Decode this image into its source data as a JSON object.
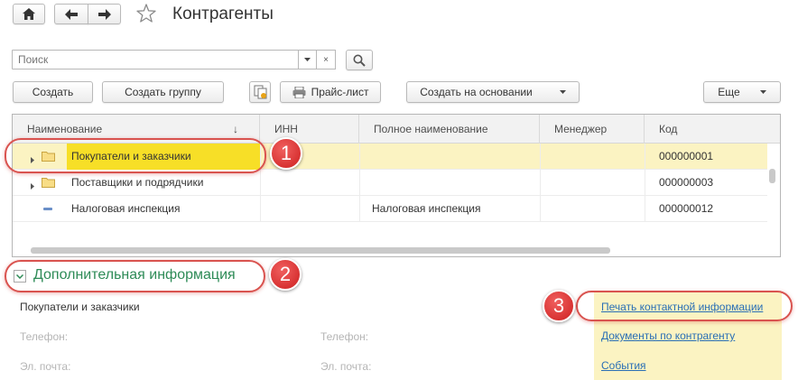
{
  "header": {
    "title": "Контрагенты"
  },
  "search": {
    "placeholder": "Поиск",
    "clear_label": "×"
  },
  "toolbar": {
    "create_label": "Создать",
    "create_group_label": "Создать группу",
    "price_list_label": "Прайс-лист",
    "create_based_label": "Создать на основании",
    "more_label": "Еще"
  },
  "table": {
    "columns": [
      "Наименование",
      "ИНН",
      "Полное наименование",
      "Менеджер",
      "Код"
    ],
    "sort_indicator": "↓",
    "rows": [
      {
        "name": "Покупатели и заказчики",
        "inn": "",
        "full_name": "",
        "manager": "",
        "code": "000000001",
        "type": "group",
        "selected": true
      },
      {
        "name": "Поставщики и подрядчики",
        "inn": "",
        "full_name": "",
        "manager": "",
        "code": "000000003",
        "type": "group",
        "selected": false
      },
      {
        "name": "Налоговая инспекция",
        "inn": "",
        "full_name": "Налоговая инспекция",
        "manager": "",
        "code": "000000012",
        "type": "item",
        "selected": false
      }
    ]
  },
  "additional_info": {
    "title": "Дополнительная информация",
    "group_name": "Покупатели и заказчики",
    "phone_label_left": "Телефон:",
    "email_label_left": "Эл. почта:",
    "phone_label_right": "Телефон:",
    "email_label_right": "Эл. почта:",
    "links": [
      "Печать контактной информации",
      "Документы по контрагенту",
      "События"
    ]
  },
  "callouts": [
    "1",
    "2",
    "3"
  ],
  "colors": {
    "selected_row": "#fbf3c2",
    "selected_cell": "#f7df27",
    "accent_green": "#2e8b57",
    "link": "#2a6fb5",
    "callout_red": "#d83232"
  }
}
